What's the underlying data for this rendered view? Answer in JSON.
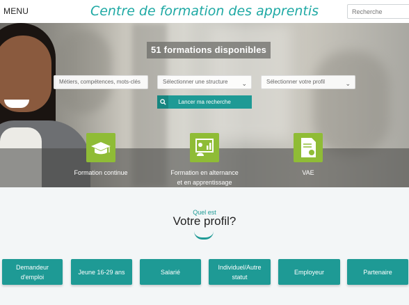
{
  "header": {
    "menu_label": "MENU",
    "site_title": "Centre de formation des apprentis",
    "search_placeholder": "Recherche"
  },
  "hero": {
    "count_label": "51 formations disponibles",
    "search_fields": [
      {
        "placeholder": "Métiers, compétences, mots-clés"
      },
      {
        "placeholder": "Sélectionner une structure"
      },
      {
        "placeholder": "Sélectionner votre profil"
      }
    ],
    "search_button": "Lancer ma recherche",
    "categories": [
      {
        "label": "Formation continue",
        "icon": "graduation-cap-icon"
      },
      {
        "label": "Formation en alternance\net en apprentissage",
        "icon": "presentation-board-icon"
      },
      {
        "label": "VAE",
        "icon": "certificate-document-icon"
      }
    ]
  },
  "profile": {
    "eyebrow": "Quel est",
    "title": "Votre profil?",
    "buttons": [
      "Demandeur\nd'emploi",
      "Jeune 16-29 ans",
      "Salarié",
      "Individuel/Autre\nstatut",
      "Employeur",
      "Partenaire"
    ]
  },
  "colors": {
    "accent": "#1e9a95",
    "title": "#1fa9a4",
    "category_icon_bg": "#8fbc36"
  }
}
